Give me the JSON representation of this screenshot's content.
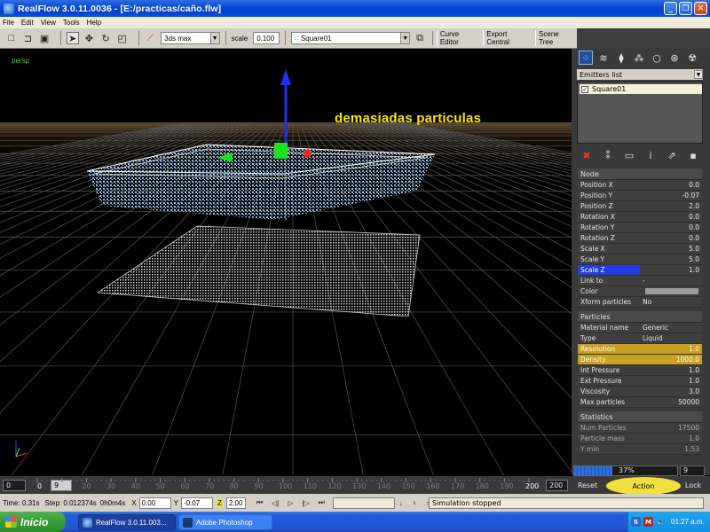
{
  "window": {
    "title": "RealFlow 3.0.11.0036 - [E:/practicas/caño.flw]",
    "controls": [
      "_",
      "❐",
      "✕"
    ]
  },
  "menu": [
    "File",
    "Edit",
    "View",
    "Tools",
    "Help"
  ],
  "toolbar": {
    "mode_select": "3ds max",
    "scale_label": "scale",
    "scale_value": "0.100",
    "object_select": "Square01",
    "buttons": [
      "Curve Editor",
      "Export Central",
      "Scene Tree"
    ]
  },
  "viewport": {
    "label": "persp",
    "annotation": "demasiadas particulas",
    "annotation_color": "#ffe600"
  },
  "right_panel": {
    "tab_icons": [
      "emitters-icon",
      "daemons-icon",
      "objects-icon",
      "constraints-icon",
      "meshes-icon",
      "waves-icon",
      "particles-icon"
    ],
    "emitters_header": "Emitters list",
    "emitters": [
      {
        "label": "Square01",
        "checked": "✓"
      }
    ],
    "node_icons": [
      "delete-icon",
      "link-icon",
      "display-icon",
      "info-icon",
      "export-icon",
      "save-icon"
    ],
    "sections": [
      {
        "title": "Node",
        "rows": [
          {
            "label": "Position X",
            "value": "0.0"
          },
          {
            "label": "Position Y",
            "value": "-0.07"
          },
          {
            "label": "Position Z",
            "value": "2.0"
          },
          {
            "label": "Rotation X",
            "value": "0.0"
          },
          {
            "label": "Rotation Y",
            "value": "0.0"
          },
          {
            "label": "Rotation Z",
            "value": "0.0"
          },
          {
            "label": "Scale X",
            "value": "5.0"
          },
          {
            "label": "Scale Y",
            "value": "5.0"
          },
          {
            "label": "Scale Z",
            "value": "1.0"
          },
          {
            "label": "Link to",
            "value": "-"
          },
          {
            "label": "Color",
            "value": ""
          },
          {
            "label": "Xform particles",
            "value": "No"
          }
        ]
      },
      {
        "title": "Particles",
        "rows": [
          {
            "label": "Material name",
            "value": "Generic"
          },
          {
            "label": "Type",
            "value": "Liquid"
          },
          {
            "label": "Resolution",
            "value": "1.0"
          },
          {
            "label": "Density",
            "value": "1000.0"
          },
          {
            "label": "Int Pressure",
            "value": "1.0"
          },
          {
            "label": "Ext Pressure",
            "value": "1.0"
          },
          {
            "label": "Viscosity",
            "value": "3.0"
          },
          {
            "label": "Max particles",
            "value": "50000"
          }
        ]
      },
      {
        "title": "Statistics",
        "rows": [
          {
            "label": "Num Particles",
            "value": "17500"
          },
          {
            "label": "Particle mass",
            "value": "1.0"
          },
          {
            "label": "Y min",
            "value": "1.53"
          }
        ]
      }
    ],
    "progress_text": "37%",
    "progress_value": 0.37,
    "frame_value": "9"
  },
  "timeline": {
    "start": "0",
    "zero_label": "0",
    "current_frame": "9",
    "ticks": [
      "20",
      "30",
      "40",
      "50",
      "60",
      "70",
      "80",
      "90",
      "100",
      "110",
      "120",
      "130",
      "140",
      "150",
      "160",
      "170",
      "180",
      "190"
    ],
    "end_label": "200",
    "end_box": "200"
  },
  "bottom_buttons": {
    "reset": "Reset",
    "action": "Action",
    "lock": "Lock"
  },
  "status": {
    "time": "Time: 0.31s",
    "step": "Step: 0.012374s",
    "elapsed": "0h0m4s",
    "x_label": "X",
    "x_value": "0.00",
    "y_label": "Y",
    "y_value": "-0.07",
    "z_label": "Z",
    "z_value": "2.00",
    "message": "Simulation stopped"
  },
  "taskbar": {
    "start": "Inicio",
    "tasks": [
      "RealFlow 3.0.11.003...",
      "Adobe Photoshop"
    ],
    "clock": "01:27 a.m."
  }
}
